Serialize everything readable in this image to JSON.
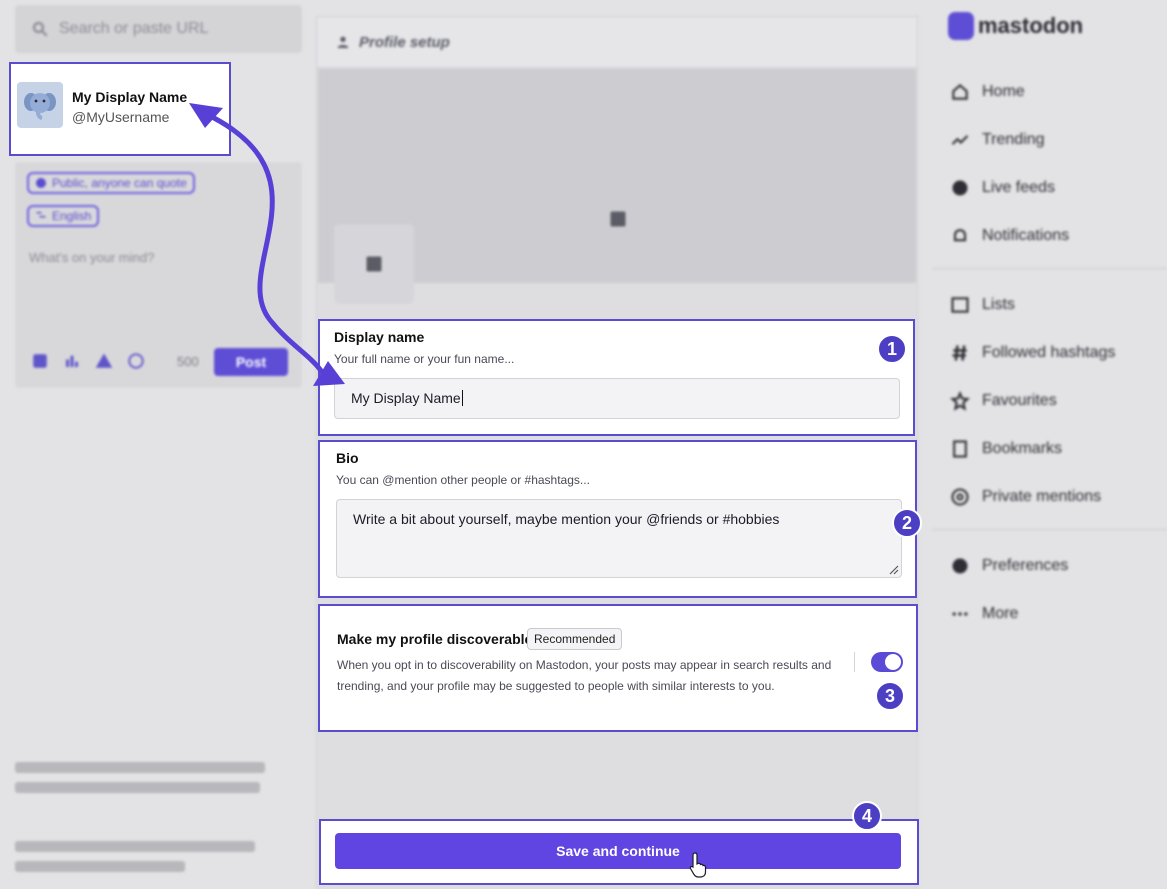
{
  "search": {
    "placeholder": "Search or paste URL"
  },
  "profile": {
    "display_name": "My Display Name",
    "username": "@MyUsername"
  },
  "compose": {
    "visibility": "Public, anyone can quote",
    "language": "English",
    "placeholder": "What's on your mind?",
    "char_count": "500",
    "post_label": "Post"
  },
  "column": {
    "title": "Profile setup"
  },
  "display_name_field": {
    "label": "Display name",
    "hint": "Your full name or your fun name...",
    "value": "My Display Name"
  },
  "bio_field": {
    "label": "Bio",
    "hint": "You can @mention other people or #hashtags...",
    "placeholder": "Write a bit about yourself, maybe mention your @friends or #hobbies"
  },
  "discoverable": {
    "label": "Make my profile discoverable",
    "badge": "Recommended",
    "description": "When you opt in to discoverability on Mastodon, your posts may appear in search results and trending, and your profile may be suggested to people with similar interests to you.",
    "enabled": true
  },
  "save_label": "Save and continue",
  "steps": [
    "1",
    "2",
    "3",
    "4"
  ],
  "nav": {
    "logo": "mastodon",
    "items": [
      "Home",
      "Trending",
      "Live feeds",
      "Notifications",
      "Lists",
      "Followed hashtags",
      "Favourites",
      "Bookmarks",
      "Private mentions",
      "Preferences",
      "More"
    ]
  },
  "colors": {
    "accent": "#5a4ccf",
    "button": "#6145e3"
  }
}
